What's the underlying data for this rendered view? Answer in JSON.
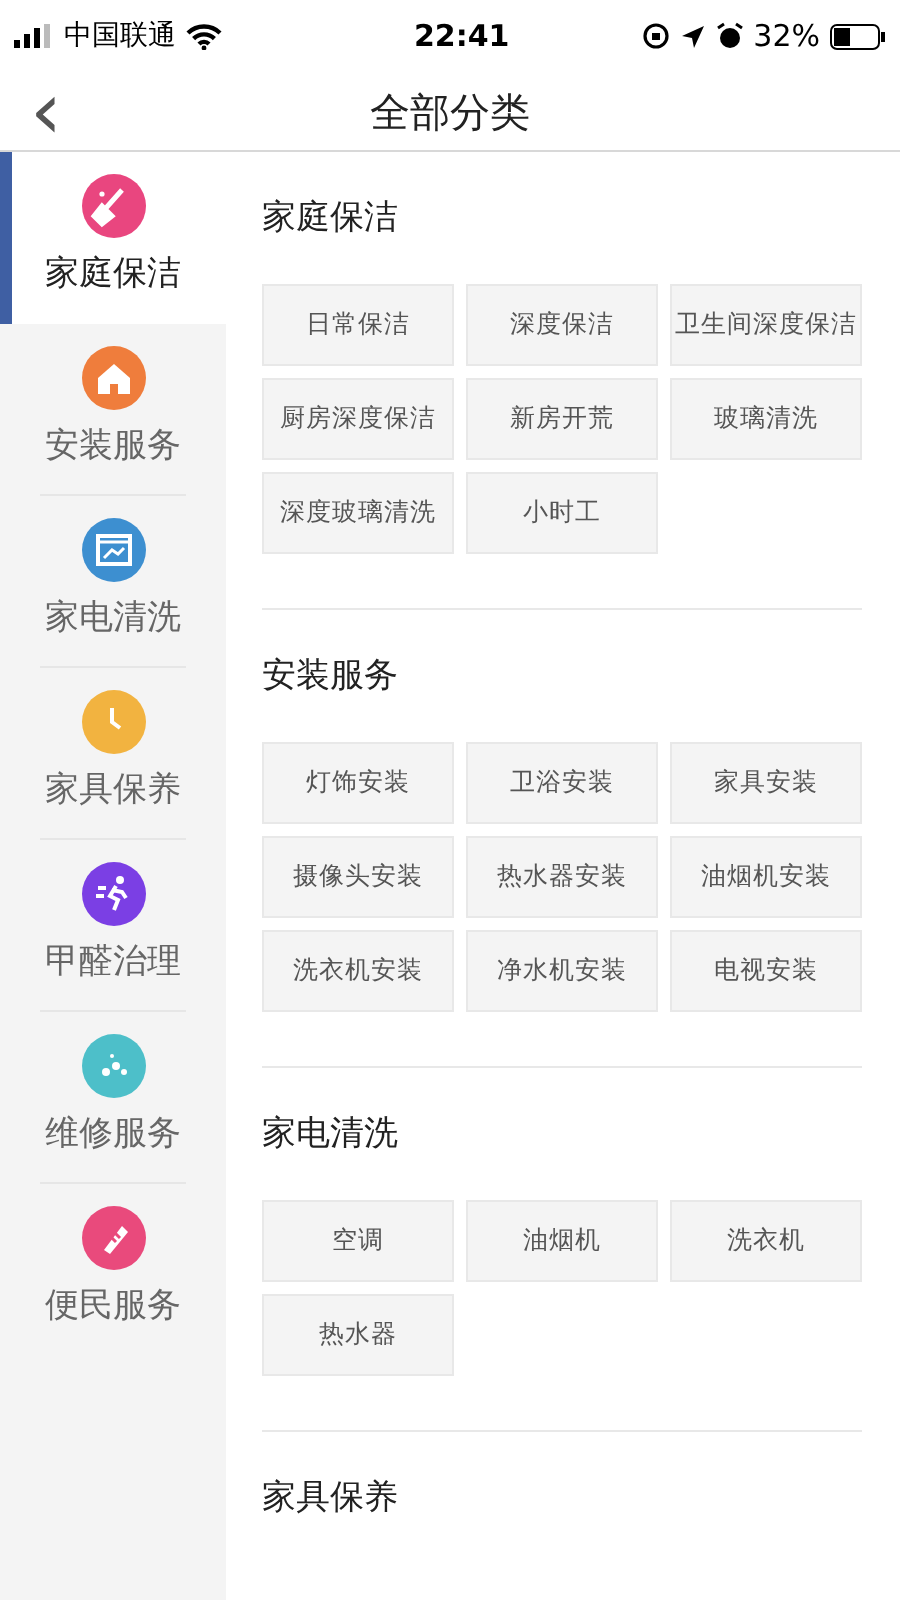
{
  "status_bar": {
    "carrier": "中国联通",
    "time": "22:41",
    "battery": "32%"
  },
  "header": {
    "title": "全部分类",
    "back": "‹"
  },
  "sidebar": {
    "items": [
      {
        "label": "家庭保洁",
        "selected": true,
        "color": "#e9467f",
        "kind": "broom"
      },
      {
        "label": "安装服务",
        "selected": false,
        "color": "#ef7d3c",
        "kind": "house"
      },
      {
        "label": "家电清洗",
        "selected": false,
        "color": "#3d8fd0",
        "kind": "shop"
      },
      {
        "label": "家具保养",
        "selected": false,
        "color": "#f2b340",
        "kind": "clock"
      },
      {
        "label": "甲醛治理",
        "selected": false,
        "color": "#7b3fe4",
        "kind": "runner"
      },
      {
        "label": "维修服务",
        "selected": false,
        "color": "#4dbfc9",
        "kind": "dots"
      },
      {
        "label": "便民服务",
        "selected": false,
        "color": "#e94a7c",
        "kind": "bottle"
      }
    ]
  },
  "sections": [
    {
      "title": "家庭保洁",
      "items": [
        "日常保洁",
        "深度保洁",
        "卫生间深度保洁",
        "厨房深度保洁",
        "新房开荒",
        "玻璃清洗",
        "深度玻璃清洗",
        "小时工"
      ]
    },
    {
      "title": "安装服务",
      "items": [
        "灯饰安装",
        "卫浴安装",
        "家具安装",
        "摄像头安装",
        "热水器安装",
        "油烟机安装",
        "洗衣机安装",
        "净水机安装",
        "电视安装"
      ]
    },
    {
      "title": "家电清洗",
      "items": [
        "空调",
        "油烟机",
        "洗衣机",
        "热水器"
      ]
    },
    {
      "title": "家具保养"
    }
  ]
}
